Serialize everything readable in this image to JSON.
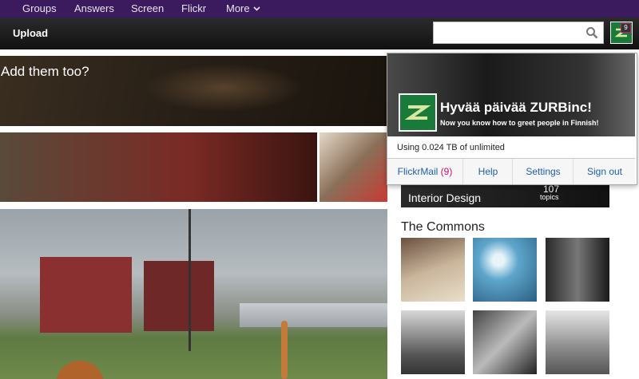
{
  "top_nav": {
    "items": [
      "Groups",
      "Answers",
      "Screen",
      "Flickr",
      "More"
    ]
  },
  "toolbar": {
    "upload_label": "Upload",
    "search": {
      "value": "",
      "placeholder": ""
    },
    "notification_count": "9"
  },
  "content": {
    "hero_title": "Add them too?",
    "group_tile": {
      "name": "Interior Design",
      "count": "107",
      "unit": "topics"
    },
    "commons_title": "The Commons"
  },
  "account_menu": {
    "greeting": "Hyvää päivää ZURBinc!",
    "subtitle": "Now you know how to greet people in Finnish!",
    "usage": "Using 0.024 TB of unlimited",
    "actions": {
      "mail_label": "FlickrMail",
      "mail_count": "(9)",
      "help": "Help",
      "settings": "Settings",
      "signout": "Sign out"
    }
  },
  "colors": {
    "nav_bg": "#3b1a5e",
    "accent_link": "#1f5fae",
    "badge": "#d40e6e"
  }
}
